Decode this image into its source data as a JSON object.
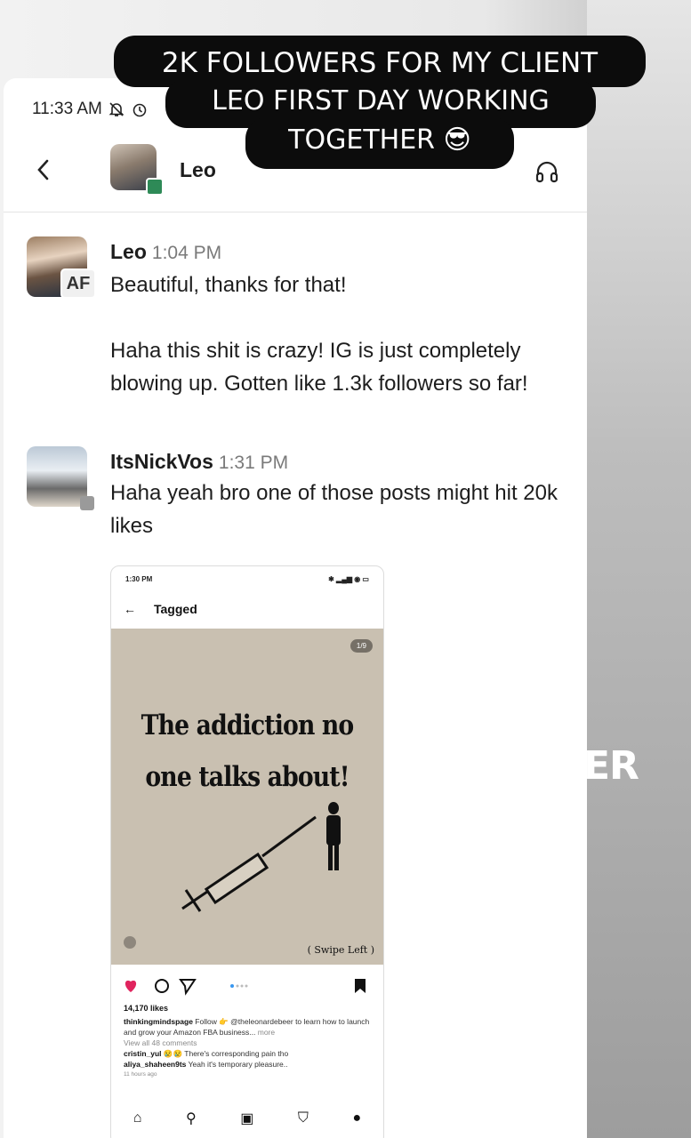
{
  "overlay": {
    "line1": "2K FOLLOWERS FOR MY CLIENT",
    "line2": "LEO FIRST DAY WORKING",
    "line3": "TOGETHER 😎",
    "bg_edge_text": "ER"
  },
  "statusbar": {
    "time": "11:33 AM"
  },
  "header": {
    "contact_name": "Leo"
  },
  "messages": [
    {
      "sender": "Leo",
      "time": "1:04 PM",
      "badge": "AF",
      "lines": [
        "Beautiful, thanks for that!",
        "Haha this shit is crazy! IG is just completely blowing up. Gotten like 1.3k followers so far!"
      ]
    },
    {
      "sender": "ItsNickVos",
      "time": "1:31 PM",
      "lines": [
        "Haha yeah bro one of those posts might hit 20k likes"
      ]
    }
  ],
  "attachment": {
    "status_time": "1:30 PM",
    "page_title": "Tagged",
    "counter": "1/9",
    "post_title_l1": "The addiction no",
    "post_title_l2": "one talks about!",
    "swipe": "( Swipe Left )",
    "likes": "14,170 likes",
    "caption_user": "thinkingmindspage",
    "caption_text": "Follow 👉 @theleonardebeer to learn how to launch and grow your Amazon FBA business...",
    "caption_more": "more",
    "view_comments": "View all 48 comments",
    "comment1_user": "cristin_yul",
    "comment1_text": "😢😢 There's corresponding pain tho",
    "comment2_user": "aliya_shaheen9ts",
    "comment2_text": "Yeah it's temporary pleasure..",
    "posted_ago": "11 hours ago"
  }
}
